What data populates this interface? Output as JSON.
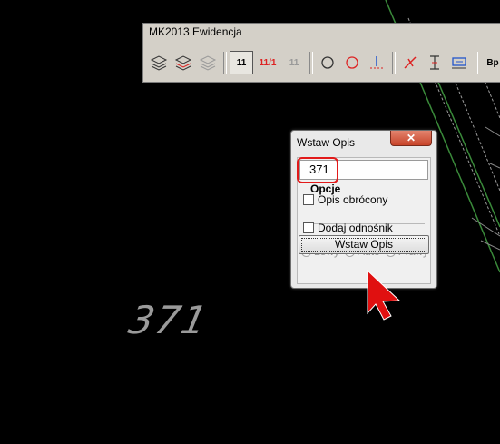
{
  "toolbar": {
    "title": "MK2013 Ewidencja",
    "buttons": [
      {
        "label": "",
        "icon": "layers-icon"
      },
      {
        "label": "",
        "icon": "layers-red-icon"
      },
      {
        "label": "",
        "icon": "layers-gray-icon"
      },
      {
        "label": "11",
        "icon": "number-icon"
      },
      {
        "label": "11/1",
        "icon": "fraction-number-icon"
      },
      {
        "label": "11",
        "icon": "number-gray-icon"
      },
      {
        "label": "",
        "icon": "circle-icon"
      },
      {
        "label": "",
        "icon": "circle-red-icon"
      },
      {
        "label": "",
        "icon": "point-marker-icon"
      },
      {
        "label": "",
        "icon": "red-cross-line-icon"
      },
      {
        "label": "",
        "icon": "dimension-icon"
      },
      {
        "label": "",
        "icon": "blue-symbol-icon"
      },
      {
        "label": "Bp",
        "icon": "bp-icon"
      }
    ]
  },
  "dialog": {
    "title": "Wstaw Opis",
    "close_label": "✕",
    "input_value": "371",
    "group_label": "Opcje",
    "checkbox_rotated": "Opis obrócony",
    "checkbox_reference": "Dodaj odnośnik",
    "radio_left": "Lewy",
    "radio_auto": "Auto",
    "radio_right": "Prawy",
    "insert_button": "Wstaw Opis"
  },
  "canvas": {
    "label": "371"
  },
  "colors": {
    "highlight": "#e21a1a",
    "cad_line": "#3a8a3a",
    "background": "#000000"
  }
}
